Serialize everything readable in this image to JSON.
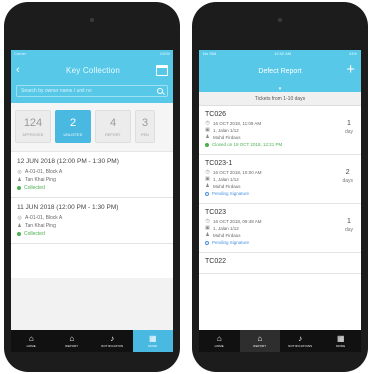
{
  "left": {
    "status": {
      "carrier": "Carrier",
      "right": "100%"
    },
    "title": "Key Collection",
    "search_placeholder": "Search by owner name / unit no",
    "tabs": [
      {
        "count": "124",
        "label": "APPROVED"
      },
      {
        "count": "2",
        "label": "UNLISTED"
      },
      {
        "count": "4",
        "label": "REPORT"
      },
      {
        "count": "3",
        "label": "PEN"
      }
    ],
    "cards": [
      {
        "date": "12 JUN 2018 (12:00 PM - 1:30 PM)",
        "unit": "A-01-01, Block A",
        "owner": "Tan Khai Ping",
        "status": "Collected"
      },
      {
        "date": "11 JUN 2018 (12:00 PM - 1:30 PM)",
        "unit": "A-01-01, Block A",
        "owner": "Tan Khai Ping",
        "status": "Collected"
      }
    ],
    "tabbar": [
      {
        "icon": "home-icon",
        "label": "HOME"
      },
      {
        "icon": "report-icon",
        "label": "REPORT"
      },
      {
        "icon": "bell-icon",
        "label": "NOTIFICATION"
      },
      {
        "icon": "grid-icon",
        "label": "MORE"
      }
    ]
  },
  "right": {
    "status": {
      "carrier": "No SIM",
      "time": "12:02 AM",
      "battery": "41%"
    },
    "title": "Defect Report",
    "plus_label": "+",
    "tickets_header": "Tickets from 1-10 days",
    "tickets": [
      {
        "id": "TC026",
        "date": "16 OCT 2018, 11:09 AM",
        "unit": "1, Jalan 1/12",
        "person": "Muhd Firdaus",
        "status": "Closed on 19 OCT 2018, 12:21 PM",
        "status_type": "closed",
        "days_num": "1",
        "days_unit": "day"
      },
      {
        "id": "TC023-1",
        "date": "16 OCT 2018, 10:00 AM",
        "unit": "1, Jalan 1/12",
        "person": "Muhd Firdaus",
        "status": "Pending Signature",
        "status_type": "pending",
        "days_num": "2",
        "days_unit": "days"
      },
      {
        "id": "TC023",
        "date": "16 OCT 2018, 09:48 AM",
        "unit": "1, Jalan 1/12",
        "person": "Muhd Firdaus",
        "status": "Pending Signature",
        "status_type": "pending",
        "days_num": "1",
        "days_unit": "day"
      },
      {
        "id": "TC022",
        "date": "",
        "unit": "",
        "person": "",
        "status": "",
        "status_type": "",
        "days_num": "",
        "days_unit": ""
      }
    ],
    "tabbar": [
      {
        "icon": "home-icon",
        "label": "HOME"
      },
      {
        "icon": "report-icon",
        "label": "REPORT"
      },
      {
        "icon": "bell-icon",
        "label": "NOTIFICATIONS"
      },
      {
        "icon": "grid-icon",
        "label": "MORE"
      }
    ]
  },
  "colors": {
    "accent": "#58c8e8",
    "active_tab": "#4ab9e2",
    "collected": "#4caf50",
    "pending": "#4a90e2",
    "tabbar": "#111111"
  }
}
